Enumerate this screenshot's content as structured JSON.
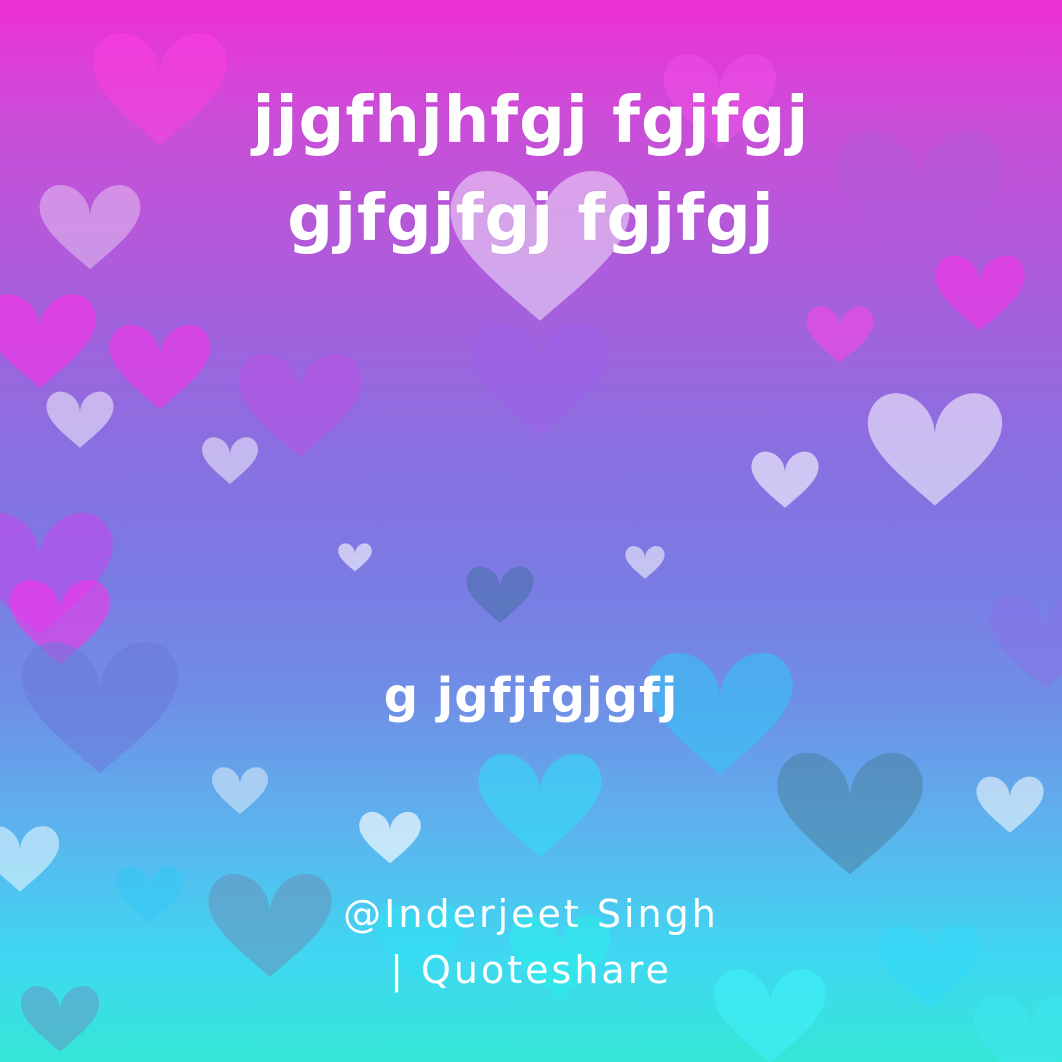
{
  "quote": {
    "line1": "jjgfhjhfgj fgjfgj",
    "line2": "gjfgjfgj fgjfgj"
  },
  "subtitle": "g jgfjfgjgfj",
  "credit": {
    "line1": "@Inderjeet Singh",
    "line2": "| Quoteshare"
  },
  "colors": {
    "top": "#ee2fd6",
    "middle": "#8a6fe0",
    "bottom": "#34e7d6",
    "text": "#ffffff"
  },
  "background_motif": "heart-icon"
}
